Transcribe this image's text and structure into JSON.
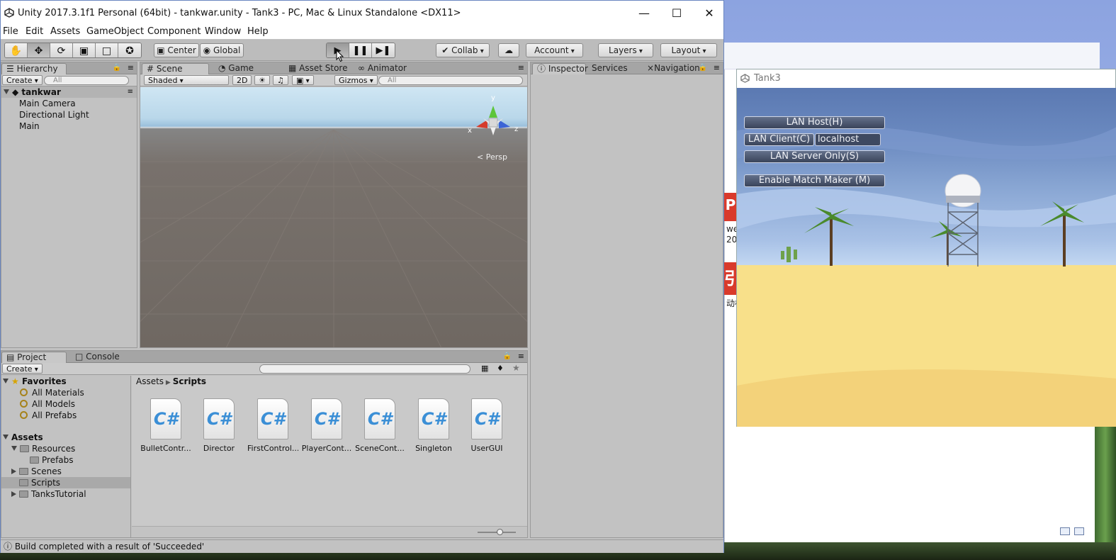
{
  "editor": {
    "title": "Unity 2017.3.1f1 Personal (64bit) - tankwar.unity - Tank3 - PC, Mac & Linux Standalone <DX11>",
    "menu": [
      "File",
      "Edit",
      "Assets",
      "GameObject",
      "Component",
      "Window",
      "Help"
    ],
    "toolbar": {
      "center": "Center",
      "global": "Global",
      "collab": "Collab",
      "account": "Account",
      "layers": "Layers",
      "layout": "Layout"
    },
    "status": "Build completed with a result of 'Succeeded'"
  },
  "hierarchy": {
    "tab": "Hierarchy",
    "create": "Create",
    "search_placeholder": "All",
    "scene": "tankwar",
    "objects": [
      "Main Camera",
      "Directional Light",
      "Main"
    ]
  },
  "scene_panel": {
    "tabs": [
      "Scene",
      "Game",
      "Asset Store",
      "Animator"
    ],
    "shading": "Shaded",
    "mode2d": "2D",
    "gizmos": "Gizmos",
    "search_placeholder": "All",
    "persp": "Persp",
    "axes": {
      "x": "x",
      "y": "y",
      "z": "z"
    }
  },
  "inspector": {
    "tabs": [
      "Inspector",
      "Services",
      "Navigation"
    ]
  },
  "project": {
    "tabs": [
      "Project",
      "Console"
    ],
    "create": "Create",
    "breadcrumb": [
      "Assets",
      "Scripts"
    ],
    "favorites": {
      "label": "Favorites",
      "items": [
        "All Materials",
        "All Models",
        "All Prefabs"
      ]
    },
    "assets": {
      "label": "Assets",
      "resources": "Resources",
      "prefabs": "Prefabs",
      "scenes": "Scenes",
      "scripts": "Scripts",
      "tanks_tutorial": "TanksTutorial"
    },
    "files": [
      "BulletContr...",
      "Director",
      "FirstControl...",
      "PlayerCont...",
      "SceneCont...",
      "Singleton",
      "UserGUI"
    ],
    "file_icon_glyph": "C#"
  },
  "game_window": {
    "title": "Tank3",
    "buttons": {
      "lan_host": "LAN Host(H)",
      "lan_client": "LAN Client(C)",
      "lan_server": "LAN Server Only(S)",
      "match_maker": "Enable Match Maker (M)"
    },
    "address": "localhost"
  },
  "behind": {
    "tile1": "P",
    "text1": "wer",
    "text2": "20",
    "tile2": "引",
    "text3": "动标"
  },
  "colors": {
    "editor_bg": "#c2c2c2",
    "game_button": "#3a445a",
    "csharp_blue": "#3b8fd6"
  }
}
